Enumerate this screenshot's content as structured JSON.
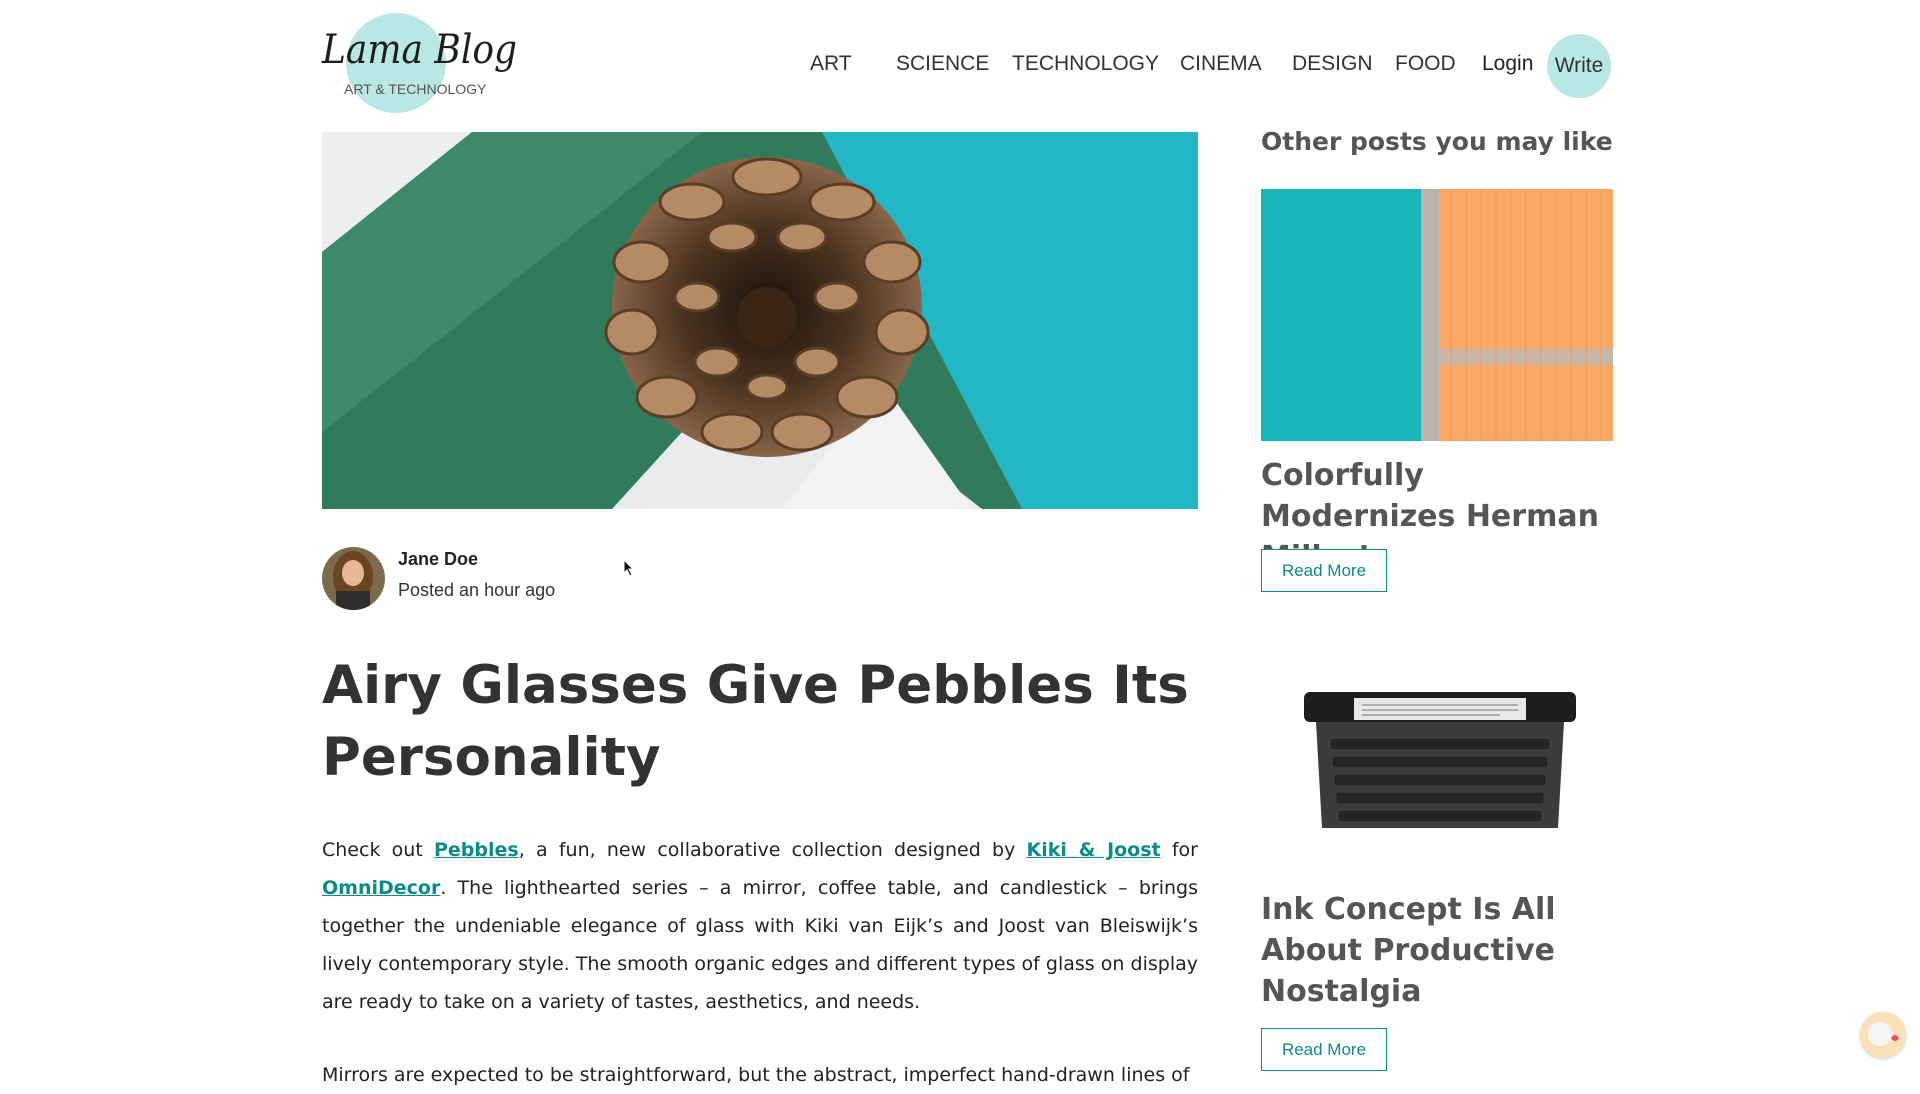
{
  "header": {
    "logo_text": "Lama Blog",
    "logo_tagline": "ART & TECHNOLOGY",
    "nav": [
      "ART",
      "SCIENCE",
      "TECHNOLOGY",
      "CINEMA",
      "DESIGN",
      "FOOD"
    ],
    "login_label": "Login",
    "write_label": "Write"
  },
  "post": {
    "author": "Jane Doe",
    "posted": "Posted an hour ago",
    "title": "Airy Glasses Give Pebbles Its Personality",
    "paragraph1": {
      "t1": "Check out ",
      "link1": "Pebbles",
      "t2": ", a fun, new collaborative collection designed by ",
      "link2": "Kiki & Joost",
      "t3": " for ",
      "link3": "OmniDecor",
      "t4": ". The lighthearted series – a mirror, coffee table, and candlestick – brings together the undeniable elegance of glass with Kiki van Eijk’s and Joost van Bleiswijk’s lively contemporary style. The smooth organic edges and different types of glass on display are ready to take on a variety of tastes, aesthetics, and needs."
    },
    "paragraph2": "Mirrors are expected to be straightforward, but the abstract, imperfect hand-drawn lines of"
  },
  "sidebar": {
    "heading": "Other posts you may like",
    "posts": [
      {
        "title": "Colorfully Modernizes Herman Miller’s",
        "button": "Read More"
      },
      {
        "title": "Ink Concept Is All About Productive Nostalgia",
        "button": "Read More"
      }
    ]
  },
  "colors": {
    "accent": "#0d8a8a",
    "logo_circle": "#b9e7e5"
  }
}
